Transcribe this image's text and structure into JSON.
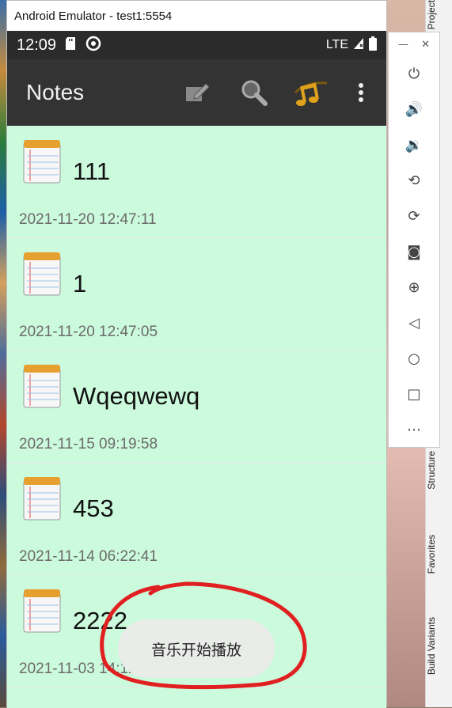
{
  "window": {
    "title": "Android Emulator - test1:5554"
  },
  "status_bar": {
    "time": "12:09",
    "network": "LTE"
  },
  "app_bar": {
    "title": "Notes"
  },
  "notes": [
    {
      "title": "111",
      "date": "2021-11-20 12:47:11"
    },
    {
      "title": "1",
      "date": "2021-11-20 12:47:05"
    },
    {
      "title": "Wqeqwewq",
      "date": "2021-11-15 09:19:58"
    },
    {
      "title": "453",
      "date": "2021-11-14 06:22:41"
    },
    {
      "title": "2222",
      "date": "2021-11-03 14:12:59"
    }
  ],
  "toast": {
    "text": "音乐开始播放"
  },
  "emulator_controls": [
    "power-icon",
    "volume-up-icon",
    "volume-down-icon",
    "rotate-left-icon",
    "rotate-right-icon",
    "camera-icon",
    "zoom-icon",
    "back-icon",
    "home-icon",
    "overview-icon",
    "more-icon"
  ],
  "ide_tool_windows": {
    "project": "Project",
    "structure": "Structure",
    "favorites": "Favorites",
    "build_variants": "Build Variants"
  },
  "colors": {
    "list_background": "#ccfadc",
    "app_bar": "#333333",
    "status_bar": "#2b2b2b",
    "annotation": "#e02020",
    "music_icon": "#e0a21c"
  }
}
